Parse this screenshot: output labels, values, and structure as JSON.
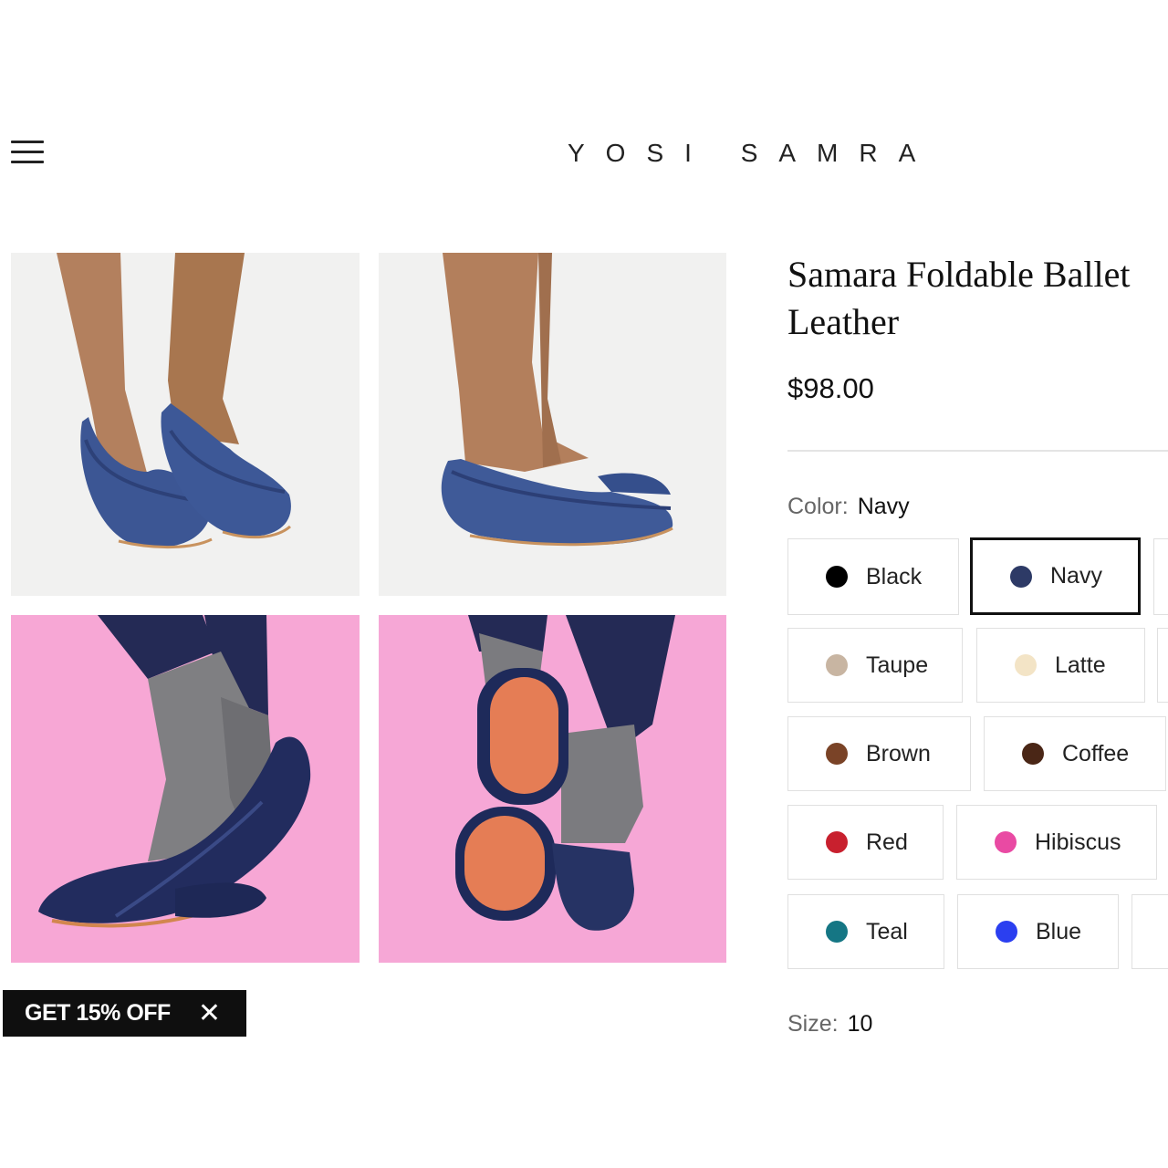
{
  "header": {
    "brand": "YOSI SAMRA",
    "menu_icon": "hamburger-menu-icon"
  },
  "gallery": {
    "images": [
      {
        "alt": "navy flats front view"
      },
      {
        "alt": "navy flats side view"
      },
      {
        "alt": "navy flats with socks on pink"
      },
      {
        "alt": "navy flats soles on pink"
      }
    ]
  },
  "promo": {
    "label": "GET 15% OFF",
    "close_glyph": "✕"
  },
  "product": {
    "title": "Samara Foldable Ballet Leather",
    "price": "$98.00",
    "color_label": "Color:",
    "color_value": "Navy",
    "size_label": "Size:",
    "size_value": "10",
    "colors": [
      {
        "name": "Black",
        "hex": "#000000",
        "selected": false
      },
      {
        "name": "Navy",
        "hex": "#2d3a66",
        "selected": true
      },
      {
        "name": "Taupe",
        "hex": "#c8b5a2",
        "selected": false
      },
      {
        "name": "Latte",
        "hex": "#f3e4c6",
        "selected": false
      },
      {
        "name": "Brown",
        "hex": "#7a4327",
        "selected": false
      },
      {
        "name": "Coffee",
        "hex": "#4a2616",
        "selected": false
      },
      {
        "name": "Red",
        "hex": "#c8202e",
        "selected": false
      },
      {
        "name": "Hibiscus",
        "hex": "#e94aa3",
        "selected": false
      },
      {
        "name": "Teal",
        "hex": "#157684",
        "selected": false
      },
      {
        "name": "Blue",
        "hex": "#2b3ff0",
        "selected": false
      }
    ]
  }
}
